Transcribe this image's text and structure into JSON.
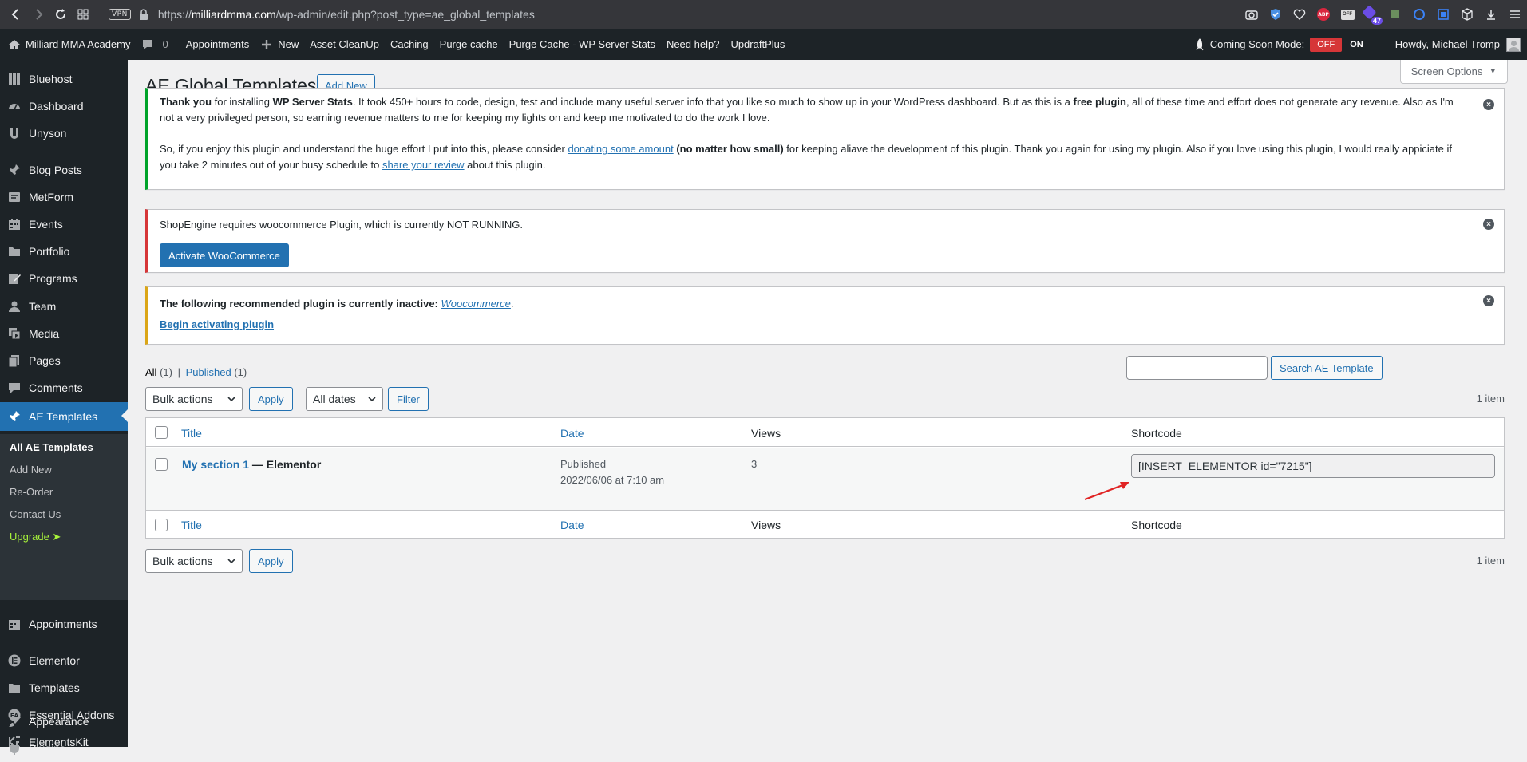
{
  "browser": {
    "url_prefix": "https://",
    "url_host": "milliardmma.com",
    "url_path": "/wp-admin/edit.php?post_type=ae_global_templates",
    "vpn_label": "VPN",
    "ext_abp": "ABP",
    "ext_off": "OFF",
    "ext_badge": "47"
  },
  "adminbar": {
    "site_name": "Milliard MMA Academy",
    "comments_count": "0",
    "items": [
      "Appointments",
      "New",
      "Asset CleanUp",
      "Caching",
      "Purge cache",
      "Purge Cache - WP Server Stats",
      "Need help?",
      "UpdraftPlus"
    ],
    "coming_soon_label": "Coming Soon Mode:",
    "coming_off": "OFF",
    "coming_on": "ON",
    "howdy": "Howdy, Michael Tromp"
  },
  "sidebar": {
    "items": [
      "Bluehost",
      "Dashboard",
      "Unyson",
      "Blog Posts",
      "MetForm",
      "Events",
      "Portfolio",
      "Programs",
      "Team",
      "Media",
      "Pages",
      "Comments",
      "AE Templates",
      "Appointments",
      "Elementor",
      "Templates",
      "Essential Addons",
      "ElementsKit",
      "Appearance",
      "Plugins"
    ],
    "submenu": [
      "All AE Templates",
      "Add New",
      "Re-Order",
      "Contact Us",
      "Upgrade ➤"
    ]
  },
  "page": {
    "title": "AE Global Templates",
    "add_new": "Add New",
    "screen_options": "Screen Options"
  },
  "notices": {
    "wpss": {
      "p1_strong1": "Thank you",
      "p1_a": " for installing ",
      "p1_strong2": "WP Server Stats",
      "p1_b": ". It took 450+ hours to code, design, test and include many useful server info that you like so much to show up in your WordPress dashboard. But as this is a ",
      "p1_strong3": "free plugin",
      "p1_c": ", all of these time and effort does not generate any revenue. Also as I'm not a very privileged person, so earning revenue matters to me for keeping my lights on and keep me motivated to do the work I love.",
      "p2_a": "So, if you enjoy this plugin and understand the huge effort I put into this, please consider ",
      "p2_link1": "donating some amount",
      "p2_strong": " (no matter how small)",
      "p2_b": " for keeping aliave the development of this plugin. Thank you again for using my plugin. Also if you love using this plugin, I would really appiciate if you take 2 minutes out of your busy schedule to ",
      "p2_link2": "share your review",
      "p2_c": " about this plugin."
    },
    "shop": {
      "text": "ShopEngine requires woocommerce Plugin, which is currently NOT RUNNING.",
      "button": "Activate WooCommerce"
    },
    "tgm": {
      "text": "The following recommended plugin is currently inactive: ",
      "plugin": "Woocommerce",
      "period": ".",
      "link": "Begin activating plugin"
    }
  },
  "list": {
    "filter_all": "All",
    "filter_all_count": "(1)",
    "filter_sep": "|",
    "filter_published": "Published",
    "filter_published_count": "(1)",
    "search_button": "Search AE Template",
    "search_value": "",
    "bulk_actions": "Bulk actions",
    "apply": "Apply",
    "all_dates": "All dates",
    "filter": "Filter",
    "items_count": "1 item",
    "columns": [
      "Title",
      "Date",
      "Views",
      "Shortcode"
    ],
    "rows": [
      {
        "title": "My section 1",
        "suffix": " — Elementor",
        "status": "Published",
        "date": "2022/06/06 at 7:10 am",
        "views": "3",
        "shortcode": "[INSERT_ELEMENTOR id=\"7215\"]"
      }
    ]
  },
  "colors": {
    "accent": "#2271b1",
    "adminbar": "#1d2327",
    "success": "#00a32a",
    "error": "#d63638",
    "warning": "#dba617",
    "annotation_arrow": "#e02424"
  }
}
